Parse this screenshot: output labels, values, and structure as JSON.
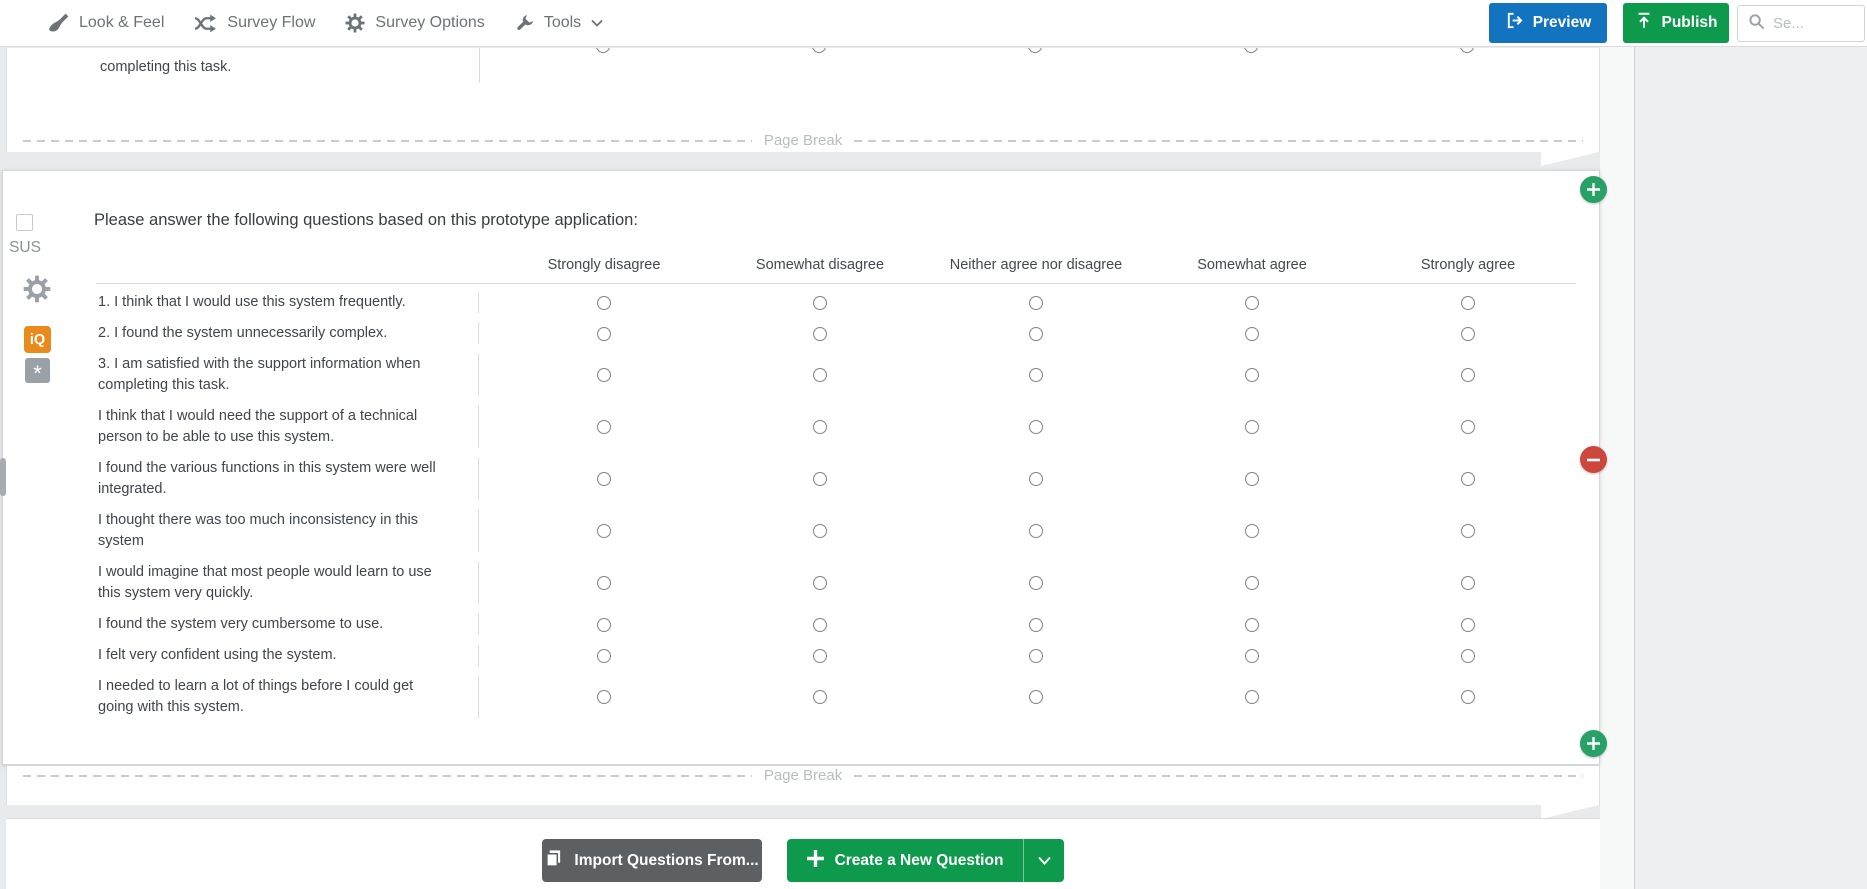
{
  "toolbar": {
    "items": [
      {
        "label": "Look & Feel",
        "icon": "paintbrush-icon"
      },
      {
        "label": "Survey Flow",
        "icon": "flow-icon"
      },
      {
        "label": "Survey Options",
        "icon": "gear-icon"
      },
      {
        "label": "Tools",
        "icon": "wrench-icon"
      }
    ],
    "preview_label": "Preview",
    "publish_label": "Publish",
    "search_placeholder": "Se..."
  },
  "previous_question": {
    "tail_text": "completing this task."
  },
  "page_break": {
    "label": "Page Break"
  },
  "question_block": {
    "id_label": "SUS",
    "question_text": "Please answer the following questions based on this prototype application:",
    "iq_badge_label": "iQ",
    "default_choice_glyph": "*",
    "matrix": {
      "columns": [
        "Strongly disagree",
        "Somewhat disagree",
        "Neither agree nor disagree",
        "Somewhat agree",
        "Strongly agree"
      ],
      "rows": [
        "1. I think that I would use this system frequently.",
        "2. I found the system unnecessarily complex.",
        "3. I am satisfied with the support information when completing this task.",
        "I think that I would need the support of a technical person to be able to use this system.",
        "I found the various functions in this system were well integrated.",
        "I thought there was too much inconsistency in this system",
        "I would imagine that most people would learn to use this system very quickly.",
        "I found the system very cumbersome to use.",
        "I felt very confident using the system.",
        "I needed to learn a lot of things before I could get going with this system."
      ]
    }
  },
  "footer": {
    "import_label": "Import Questions From...",
    "create_label": "Create a New Question"
  },
  "colors": {
    "preview_blue": "#1273be",
    "publish_green": "#0e9a4c",
    "create_green": "#0e9a4c",
    "import_gray": "#5d6063",
    "iq_orange": "#e98a1c",
    "add_green": "#27a166",
    "remove_red": "#cd473d"
  }
}
